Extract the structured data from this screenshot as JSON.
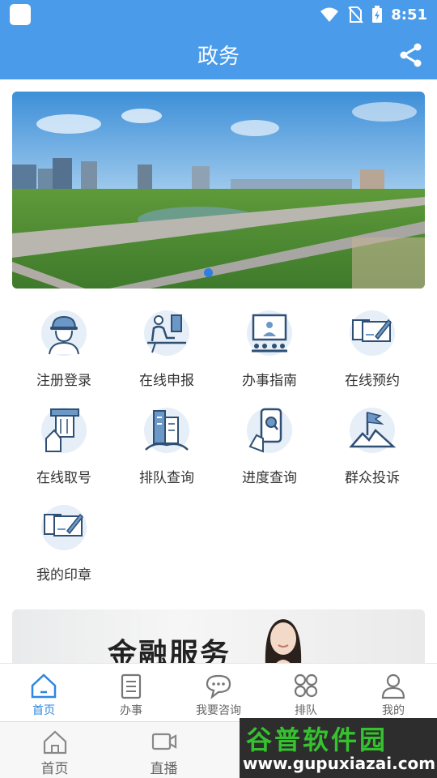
{
  "status": {
    "time": "8:51"
  },
  "header": {
    "title": "政务"
  },
  "grid": [
    {
      "label": "注册登录",
      "icon": "user-helmet-icon"
    },
    {
      "label": "在线申报",
      "icon": "desk-worker-icon"
    },
    {
      "label": "办事指南",
      "icon": "presentation-icon"
    },
    {
      "label": "在线预约",
      "icon": "form-pen-icon"
    },
    {
      "label": "在线取号",
      "icon": "ticket-hand-icon"
    },
    {
      "label": "排队查询",
      "icon": "buildings-icon"
    },
    {
      "label": "进度查询",
      "icon": "phone-search-icon"
    },
    {
      "label": "群众投诉",
      "icon": "flag-icon"
    },
    {
      "label": "我的印章",
      "icon": "seal-form-icon"
    }
  ],
  "promo": {
    "text": "金融服务"
  },
  "tabs": [
    {
      "label": "首页",
      "icon": "home-icon"
    },
    {
      "label": "办事",
      "icon": "clipboard-icon"
    },
    {
      "label": "我要咨询",
      "icon": "chat-icon"
    },
    {
      "label": "排队",
      "icon": "grid-icon"
    },
    {
      "label": "我的",
      "icon": "person-icon"
    }
  ],
  "bottom_tabs": [
    {
      "label": "首页",
      "icon": "home-icon"
    },
    {
      "label": "直播",
      "icon": "video-icon"
    }
  ],
  "watermark": {
    "title": "谷普软件园",
    "url": "www.gupuxiazai.com"
  },
  "colors": {
    "primary": "#4a9bea",
    "active": "#2f86e0"
  }
}
